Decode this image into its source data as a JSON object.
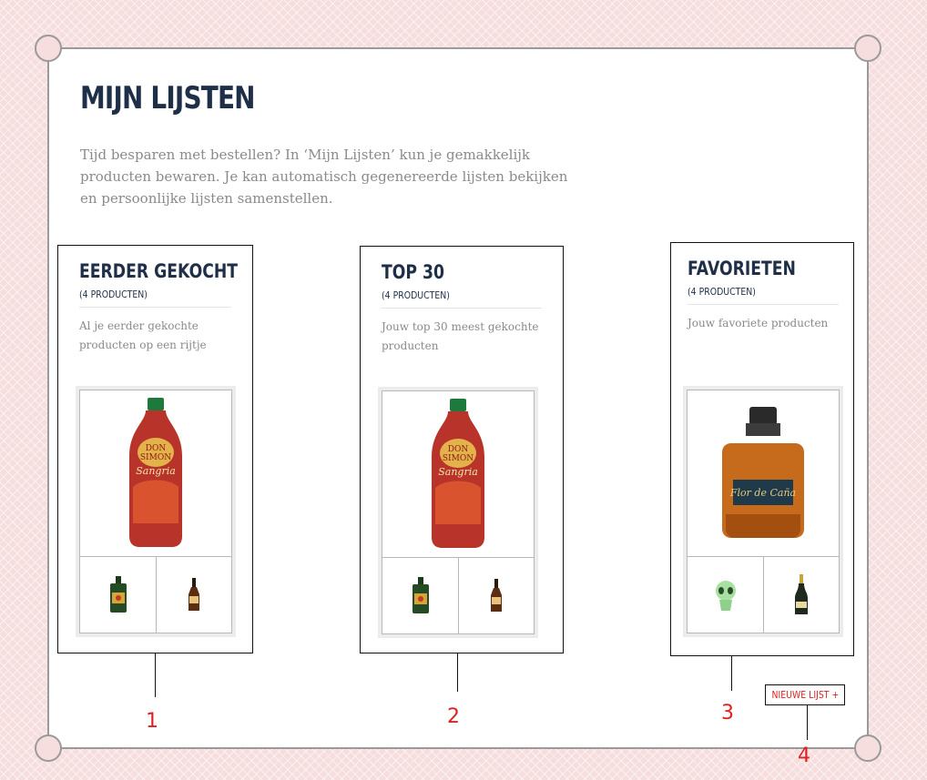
{
  "page": {
    "title": "MIJN LIJSTEN",
    "intro": "Tijd besparen met bestellen? In ‘Mijn Lijsten’ kun je gemakkelijk producten bewaren. Je kan automatisch gegenereerde lijsten bekijken en persoonlijke lijsten samenstellen."
  },
  "lists": [
    {
      "title": "EERDER GEKOCHT",
      "count": "(4 PRODUCTEN)",
      "description": "Al je eerder gekochte producten op een rijtje",
      "main_icon": "sangria-bottle-icon",
      "thumbs": [
        "green-liqueur-bottle-icon",
        "small-brown-bottle-icon"
      ]
    },
    {
      "title": "TOP 30",
      "count": "(4 PRODUCTEN)",
      "description": "Jouw top 30 meest gekochte producten",
      "main_icon": "sangria-bottle-icon",
      "thumbs": [
        "green-liqueur-bottle-icon",
        "small-brown-bottle-icon"
      ]
    },
    {
      "title": "FAVORIETEN",
      "count": "(4 PRODUCTEN)",
      "description": "Jouw favoriete producten",
      "main_icon": "rum-bottle-icon",
      "thumbs": [
        "alien-bottle-icon",
        "champagne-bottle-icon"
      ]
    }
  ],
  "new_list_button": "NIEUWE LIJST +",
  "callouts": [
    "1",
    "2",
    "3",
    "4"
  ],
  "colors": {
    "title": "#1f2f48",
    "annotation": "#e02020",
    "body_text": "#8a8a8a",
    "background": "#f7dede"
  }
}
